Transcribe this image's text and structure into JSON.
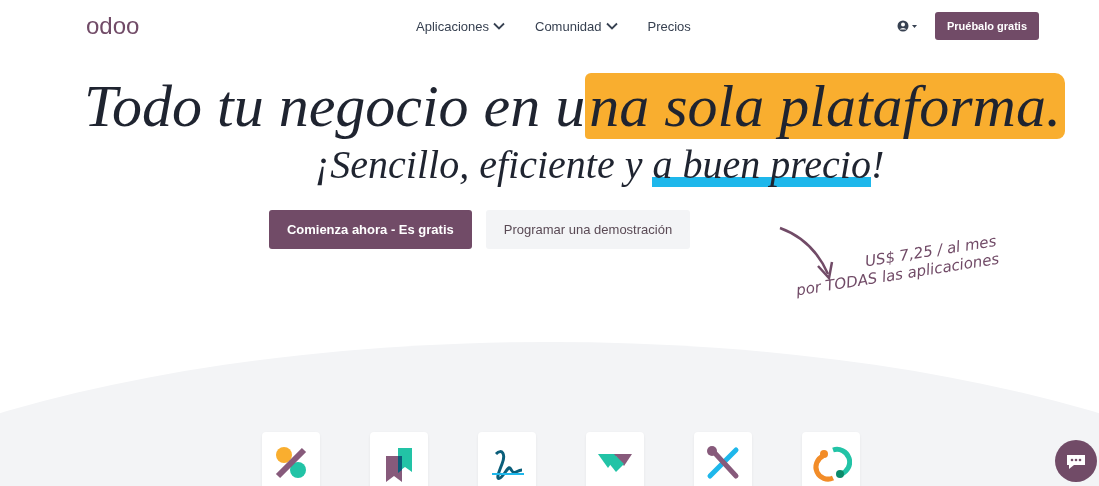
{
  "header": {
    "logo": "odoo",
    "nav": [
      {
        "label": "Aplicaciones",
        "kind": "dropdown"
      },
      {
        "label": "Comunidad",
        "kind": "dropdown"
      },
      {
        "label": "Precios",
        "kind": "link"
      }
    ],
    "cta": "Pruébalo gratis"
  },
  "hero": {
    "title": [
      {
        "text": "Todo tu negocio en u",
        "kind": "plain"
      },
      {
        "text": "na sola plataforma.",
        "kind": "marker"
      }
    ],
    "subtitle": [
      {
        "text": "¡Sencillo, eficiente y ",
        "kind": "plain"
      },
      {
        "text": "a buen precio",
        "kind": "underline"
      },
      {
        "text": "!",
        "kind": "plain"
      }
    ],
    "buttons": [
      {
        "label": "Comienza ahora - Es gratis",
        "kind": "primary"
      },
      {
        "label": "Programar una demostración",
        "kind": "secondary"
      }
    ],
    "price_note": [
      "US$ 7,25 / al mes",
      "por TODAS las aplicaciones"
    ]
  }
}
